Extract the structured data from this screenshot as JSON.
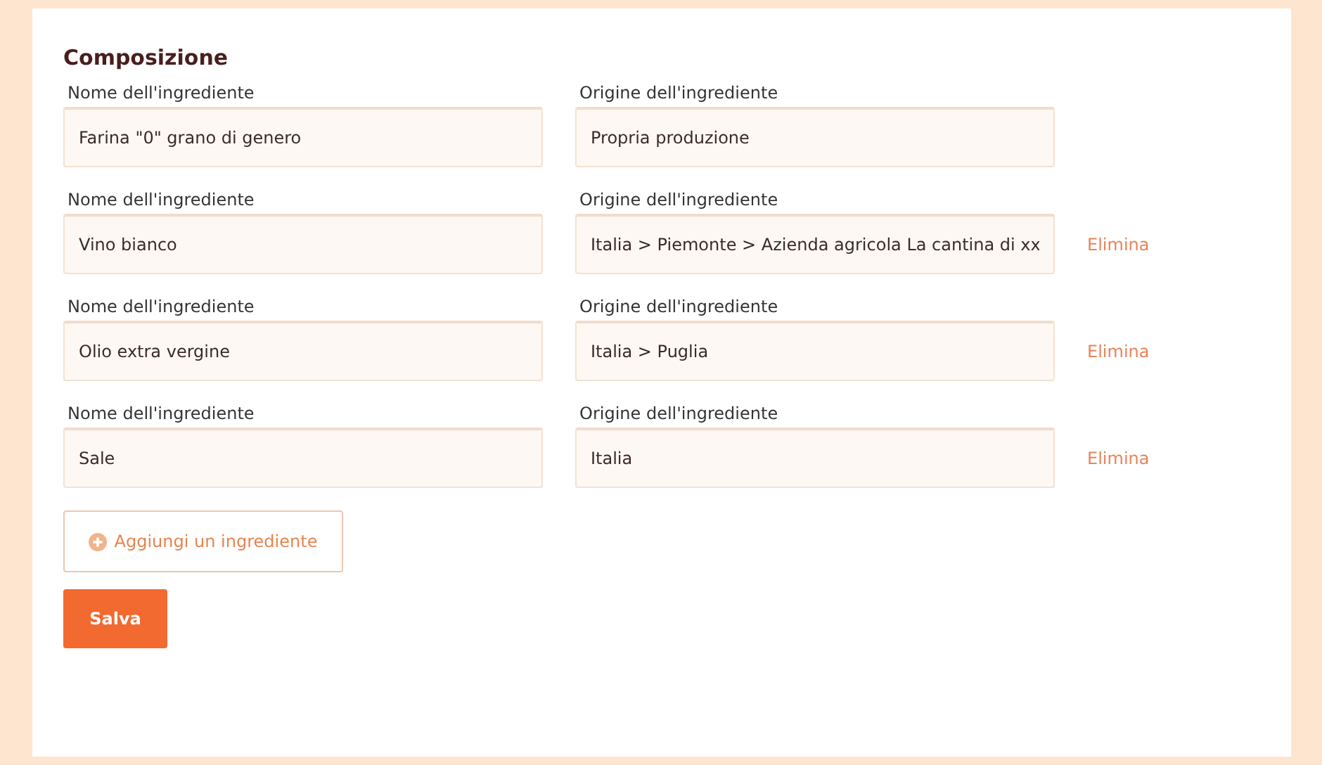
{
  "section_title": "Composizione",
  "ingredients": [
    {
      "name_label": "Nome dell'ingrediente",
      "name": "Farina \"0\" grano di genero",
      "origin_label": "Origine dell'ingrediente",
      "origin": "Propria produzione"
    },
    {
      "name_label": "Nome dell'ingrediente",
      "name": "Vino bianco",
      "origin_label": "Origine dell'ingrediente",
      "origin": "Italia > Piemonte > Azienda agricola La cantina di xx",
      "delete": "Elimina"
    },
    {
      "name_label": "Nome dell'ingrediente",
      "name": "Olio extra vergine",
      "origin_label": "Origine dell'ingrediente",
      "origin": "Italia > Puglia",
      "delete": "Elimina"
    },
    {
      "name_label": "Nome dell'ingrediente",
      "name": "Sale",
      "origin_label": "Origine dell'ingrediente",
      "origin": "Italia",
      "delete": "Elimina"
    }
  ],
  "add_button": "Aggiungi un ingrediente",
  "save_button": "Salva"
}
